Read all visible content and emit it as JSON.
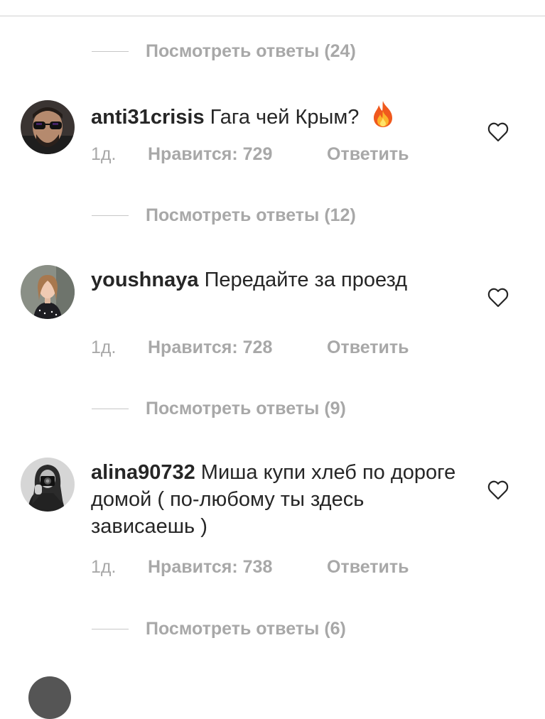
{
  "thread": {
    "view_replies": [
      "Посмотреть ответы (24)",
      "Посмотреть ответы (12)",
      "Посмотреть ответы (9)",
      "Посмотреть ответы (6)"
    ],
    "comments": [
      {
        "username": "anti31crisis",
        "text": "Гага чей Крым?",
        "emoji": "fire-emoji",
        "time": "1д.",
        "likes": "Нравится: 729",
        "reply": "Ответить"
      },
      {
        "username": "youshnaya",
        "text": "Передайте за проезд",
        "time": "1д.",
        "likes": "Нравится: 728",
        "reply": "Ответить"
      },
      {
        "username": "alina90732",
        "text": "Миша купи хлеб по дороге домой ( по-любому ты здесь зависаешь )",
        "time": "1д.",
        "likes": "Нравится: 738",
        "reply": "Ответить"
      }
    ]
  },
  "colors": {
    "primary_text": "#262626",
    "secondary_text": "#a8a8a8",
    "divider": "#c7c7c7"
  },
  "icons": {
    "like": "heart-outline-icon"
  }
}
